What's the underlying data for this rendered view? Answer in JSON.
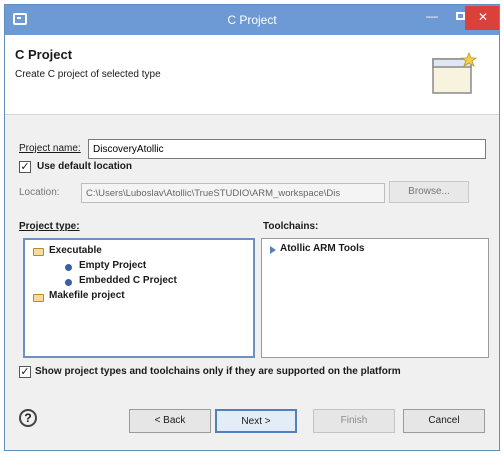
{
  "window": {
    "title": "C Project"
  },
  "header": {
    "title": "C Project",
    "description": "Create C project of selected type"
  },
  "form": {
    "project_name_label": "Project name:",
    "project_name_value": "DiscoveryAtollic",
    "use_default_location_label": "Use default location",
    "use_default_location_checked": true,
    "location_label": "Location:",
    "location_value": "C:\\Users\\Luboslav\\Atollic\\TrueSTUDIO\\ARM_workspace\\Dis",
    "browse_label": "Browse...",
    "project_type_label": "Project type:",
    "toolchains_label": "Toolchains:",
    "show_supported_label": "Show project types and toolchains only if they are supported on the platform",
    "show_supported_checked": true
  },
  "project_types": [
    {
      "label": "Executable",
      "icon": "folder-open-icon"
    },
    {
      "label": "Empty Project",
      "icon": "bullet-icon"
    },
    {
      "label": "Embedded C Project",
      "icon": "bullet-icon"
    },
    {
      "label": "Makefile project",
      "icon": "folder-open-icon"
    }
  ],
  "toolchains": [
    {
      "label": "Atollic ARM Tools"
    }
  ],
  "footer": {
    "back_label": "< Back",
    "next_label": "Next >",
    "finish_label": "Finish",
    "cancel_label": "Cancel"
  },
  "colors": {
    "titlebar": "#6d9ad4",
    "close": "#d9413a",
    "selection_border": "#4f81bd"
  }
}
